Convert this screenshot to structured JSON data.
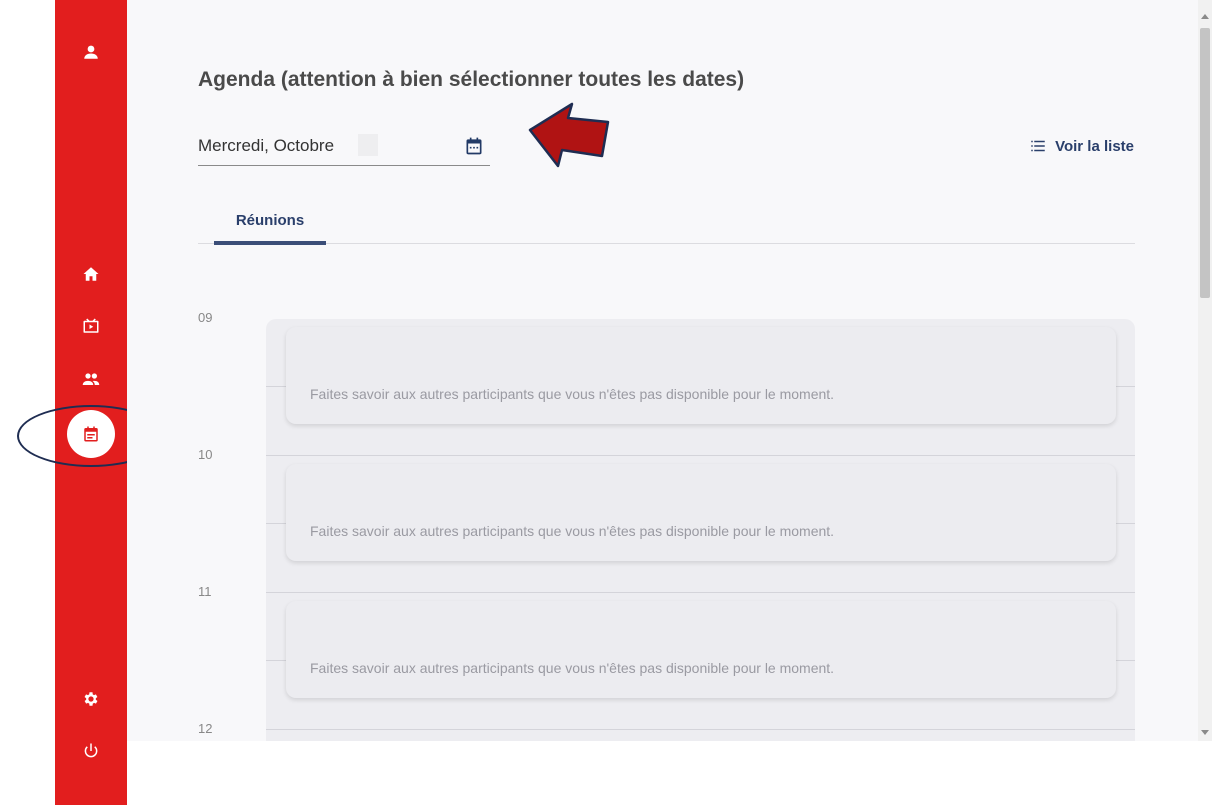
{
  "page": {
    "title": "Agenda (attention à bien sélectionner toutes les dates)"
  },
  "date_picker": {
    "value": "Mercredi, Octobre",
    "icon": "calendar-icon"
  },
  "view_list": {
    "label": "Voir la liste",
    "icon": "list-icon"
  },
  "tabs": [
    {
      "label": "Réunions",
      "active": true
    }
  ],
  "schedule": {
    "hours": [
      "09",
      "10",
      "11",
      "12"
    ],
    "slots": [
      {
        "text": "Faites savoir aux autres participants que vous n'êtes pas disponible pour le moment."
      },
      {
        "text": "Faites savoir aux autres participants que vous n'êtes pas disponible pour le moment."
      },
      {
        "text": "Faites savoir aux autres participants que vous n'êtes pas disponible pour le moment."
      }
    ]
  },
  "sidebar": {
    "items": [
      {
        "icon": "user-icon"
      },
      {
        "icon": "home-icon"
      },
      {
        "icon": "tv-icon"
      },
      {
        "icon": "group-icon"
      },
      {
        "icon": "agenda-icon",
        "active": true
      },
      {
        "icon": "gear-icon"
      },
      {
        "icon": "power-icon"
      }
    ]
  },
  "colors": {
    "sidebar": "#e21e1e",
    "accent": "#2a3f6b",
    "annotation": "#1f2d52",
    "arrow": "#b01313"
  }
}
